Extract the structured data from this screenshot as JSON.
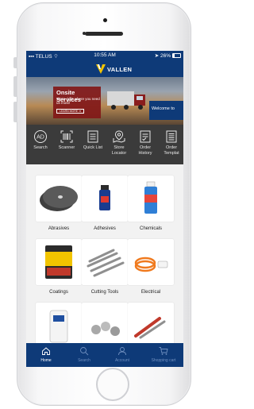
{
  "status_bar": {
    "carrier": "TELUS",
    "time": "10:55 AM",
    "battery": "26%",
    "battery_level": 0.26
  },
  "header": {
    "logo_text": "VALLEN",
    "brand_color": "#0e3a78",
    "accent_color": "#f2c400"
  },
  "banner": {
    "title": "Onsite Services",
    "subtitle": "We're right where you need us most!",
    "cta": "LEARN MORE ➔",
    "right_text": "Welcome to"
  },
  "quick_links": [
    {
      "label": "Search",
      "icon": "ad-search-icon"
    },
    {
      "label": "Scanner",
      "icon": "barcode-icon"
    },
    {
      "label": "Quick List",
      "icon": "list-icon"
    },
    {
      "label": "Store\nLocator",
      "icon": "map-icon"
    },
    {
      "label": "Order\nHistory",
      "icon": "history-icon"
    },
    {
      "label": "Order\nTemplat",
      "icon": "template-icon"
    }
  ],
  "categories": [
    {
      "label": "Abrasives",
      "image": "abrasive-disc-icon"
    },
    {
      "label": "Adhesives",
      "image": "glue-bottle-icon"
    },
    {
      "label": "Chemicals",
      "image": "spray-can-icon"
    },
    {
      "label": "Coatings",
      "image": "paint-can-icon"
    },
    {
      "label": "Cutting Tools",
      "image": "drill-bits-icon"
    },
    {
      "label": "Electrical",
      "image": "extension-cord-icon"
    },
    {
      "label": "",
      "image": "dispenser-icon"
    },
    {
      "label": "",
      "image": "fasteners-icon"
    },
    {
      "label": "",
      "image": "hand-tools-icon"
    }
  ],
  "tabs": [
    {
      "label": "Home",
      "icon": "home-icon",
      "active": true
    },
    {
      "label": "Search",
      "icon": "search-icon",
      "active": false
    },
    {
      "label": "Account",
      "icon": "account-icon",
      "active": false
    },
    {
      "label": "Shopping cart",
      "icon": "cart-icon",
      "active": false
    }
  ]
}
